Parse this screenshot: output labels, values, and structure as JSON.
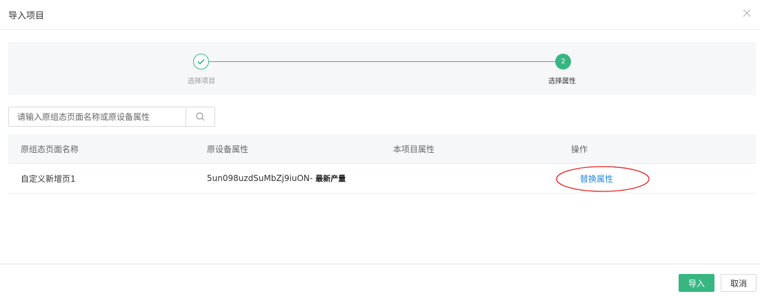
{
  "dialog": {
    "title": "导入项目",
    "close_icon": "close-icon"
  },
  "steps": {
    "items": [
      {
        "label": "选择项目",
        "status": "done",
        "icon": "check-icon"
      },
      {
        "label": "选择属性",
        "status": "current",
        "number": "2"
      }
    ],
    "active_color": "#37b682"
  },
  "search": {
    "placeholder": "请输入原组态页面名称或原设备属性",
    "value": "",
    "icon": "search-icon"
  },
  "table": {
    "columns": [
      "原组态页面名称",
      "原设备属性",
      "本项目属性",
      "操作"
    ],
    "rows": [
      {
        "page_name": "自定义新增页1",
        "device_attr_code": "5un098uzdSuMbZj9iuON-",
        "device_attr_name": "最新产量",
        "project_attr": "",
        "action": "替换属性"
      }
    ]
  },
  "footer": {
    "import_label": "导入",
    "cancel_label": "取消"
  },
  "colors": {
    "primary": "#37b682",
    "link": "#1e88e5",
    "annotation": "#e0201b"
  }
}
